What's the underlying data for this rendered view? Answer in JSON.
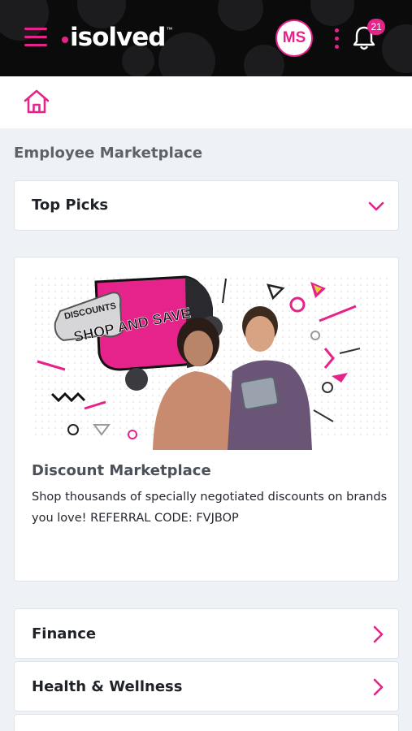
{
  "header": {
    "brand": "isolved",
    "brand_tm": "™",
    "user_initials": "MS",
    "notification_count": "21"
  },
  "page": {
    "title": "Employee Marketplace"
  },
  "sections": {
    "top_picks": "Top Picks",
    "finance": "Finance",
    "health_wellness": "Health & Wellness"
  },
  "promo": {
    "banner_tag": "DISCOUNTS",
    "banner_headline": "SHOP AND SAVE",
    "title": "Discount Marketplace",
    "description": "Shop thousands of specially negotiated discounts on brands you love! REFERRAL CODE: FVJBOP"
  },
  "colors": {
    "accent": "#e6238a",
    "header_bg": "#0b0b0c",
    "page_bg": "#eef1f6"
  },
  "icons": {
    "menu": "hamburger-icon",
    "more": "kebab-icon",
    "notifications": "bell-icon",
    "home": "home-icon",
    "expand": "chevron-down-icon",
    "navigate": "chevron-right-icon"
  }
}
